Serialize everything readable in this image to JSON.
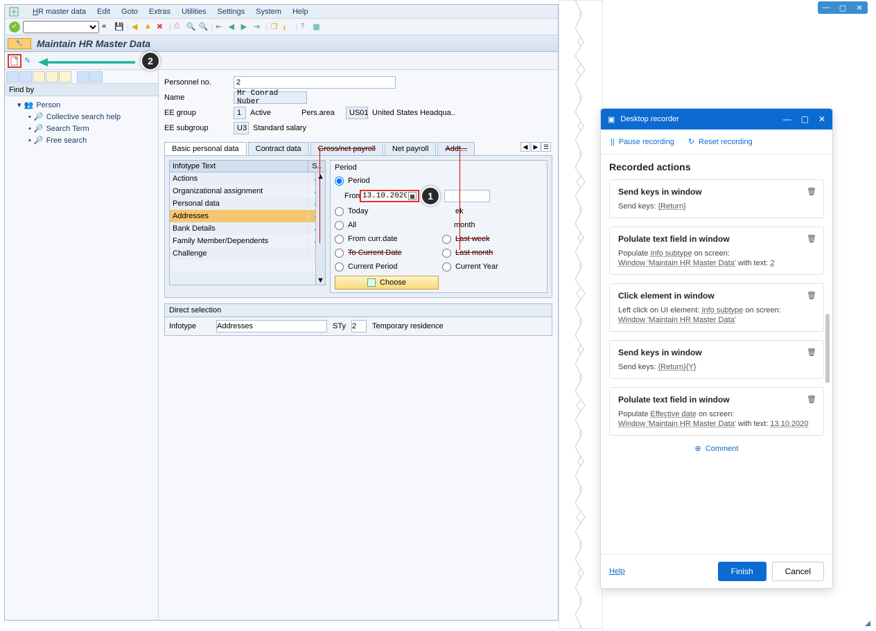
{
  "menubar": {
    "items": [
      "HR master data",
      "Edit",
      "Goto",
      "Extras",
      "Utilities",
      "Settings",
      "System",
      "Help"
    ]
  },
  "page": {
    "title": "Maintain HR Master Data"
  },
  "callouts": {
    "c1": "1",
    "c2": "2"
  },
  "sidebar": {
    "findby": "Find by",
    "root": "Person",
    "items": [
      "Collective search help",
      "Search Term",
      "Free search"
    ]
  },
  "header_fields": {
    "pers_no_label": "Personnel no.",
    "pers_no_value": "2",
    "name_label": "Name",
    "name_value": "Mr Conrad Nuber",
    "ee_group_label": "EE group",
    "ee_group_code": "1",
    "ee_group_text": "Active",
    "pers_area_label": "Pers.area",
    "pers_area_code": "US01",
    "pers_area_text": "United States Headqua..",
    "ee_subgroup_label": "EE subgroup",
    "ee_subgroup_code": "U3",
    "ee_subgroup_text": "Standard salary"
  },
  "tabs": {
    "items": [
      "Basic personal data",
      "Contract data",
      "Gross/net payroll",
      "Net payroll",
      "Addt..."
    ],
    "active": 0
  },
  "infotype": {
    "head": {
      "col1": "Infotype Text",
      "col2": "S.."
    },
    "rows": [
      {
        "t": "Actions",
        "s": true,
        "sel": false
      },
      {
        "t": "Organizational assignment",
        "s": true,
        "sel": false
      },
      {
        "t": "Personal data",
        "s": true,
        "sel": false
      },
      {
        "t": "Addresses",
        "s": true,
        "sel": true
      },
      {
        "t": "Bank Details",
        "s": true,
        "sel": false
      },
      {
        "t": "Family Member/Dependents",
        "s": true,
        "sel": false
      },
      {
        "t": "Challenge",
        "s": false,
        "sel": false
      }
    ]
  },
  "period": {
    "title": "Period",
    "radio_period": "Period",
    "from_label": "From",
    "from_value": "13.10.2020",
    "options_left": [
      "Today",
      "All",
      "From curr.date",
      "To Current Date",
      "Current Period"
    ],
    "options_right_partial": {
      "ek": "ek",
      "month": "month"
    },
    "last_week": "Last week",
    "last_month": "Last month",
    "current_year": "Current Year",
    "choose": "Choose"
  },
  "direct": {
    "title": "Direct selection",
    "infotype_label": "Infotype",
    "infotype_value": "Addresses",
    "sty_label": "STy",
    "sty_value": "2",
    "sty_text": "Temporary residence"
  },
  "recorder": {
    "title": "Desktop recorder",
    "pause": "Pause recording",
    "reset": "Reset recording",
    "heading": "Recorded actions",
    "cards": [
      {
        "title": "Send keys in window",
        "lines": [
          [
            "Send keys:",
            "{Return}"
          ]
        ]
      },
      {
        "title": "Polulate text field in window",
        "lines": [
          [
            "Populate",
            "Info subtype",
            "on screen:"
          ],
          [
            "Window 'Maintain HR Master Data'",
            "with text:",
            "2"
          ]
        ]
      },
      {
        "title": "Click element in window",
        "lines": [
          [
            "Left click on UI element:",
            "Info subtype",
            "on screen:"
          ],
          [
            "Window 'Maintain HR Master Data'"
          ]
        ]
      },
      {
        "title": "Send keys in window",
        "lines": [
          [
            "Send keys:",
            "{Return}{Y}"
          ]
        ]
      },
      {
        "title": "Polulate text field in window",
        "lines": [
          [
            "Populate",
            "Effective date",
            "on screen:"
          ],
          [
            "Window 'Maintain HR Master Data'",
            "with text:",
            "13.10.2020"
          ]
        ]
      }
    ],
    "comment": "Comment",
    "help": "Help",
    "finish": "Finish",
    "cancel": "Cancel"
  }
}
